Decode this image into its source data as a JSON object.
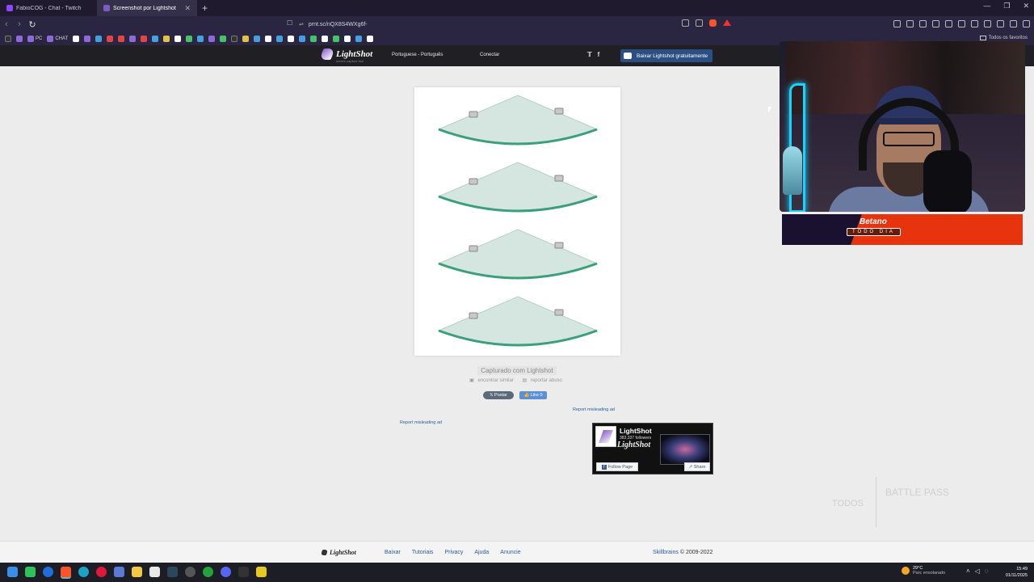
{
  "browser": {
    "tabs": [
      {
        "title": "FabioCOG - Chat - Twitch",
        "active": false
      },
      {
        "title": "Screenshot por Lightshot",
        "active": true
      }
    ],
    "url": "prnt.sc/nQX8S4WXg6f-",
    "bookmarks": [
      "PC",
      "CHAT"
    ],
    "all_favorites": "Todos os favoritos"
  },
  "header": {
    "logo": "LightShot",
    "logo_sub": "screen capture tool",
    "language": "Portuguese - Português",
    "signin": "Conectar",
    "download_button": "Baixar Lightshot gratuitamente"
  },
  "main": {
    "captured_label": "Capturado com Lightshot",
    "find_similar": "encontrar similar",
    "report_abuse": "reportar abuso",
    "post_button": "Postar",
    "like_button": "Like 0",
    "ad_link_left": "Report misleading ad",
    "ad_link_right": "Report misleading ad"
  },
  "fb_widget": {
    "name": "LightShot",
    "followers": "383,337 followers",
    "logo_text": "LightShot",
    "follow_button": "Follow Page",
    "share_button": "Share"
  },
  "overlay": {
    "betano_brand": "Betano",
    "betano_tag": "TODO DIA",
    "watermark_left": "TODOS",
    "watermark_right": "BATTLE PASS"
  },
  "footer": {
    "logo": "LightShot",
    "links": [
      "Baixar",
      "Tutoriais",
      "Privacy",
      "Ajuda",
      "Anuncie"
    ],
    "company": "Skillbrains",
    "copyright": "© 2009-2022"
  },
  "taskbar": {
    "temperature": "29°C",
    "weather": "Parc ensolarado",
    "time": "15:49",
    "date": "01/11/2025"
  }
}
